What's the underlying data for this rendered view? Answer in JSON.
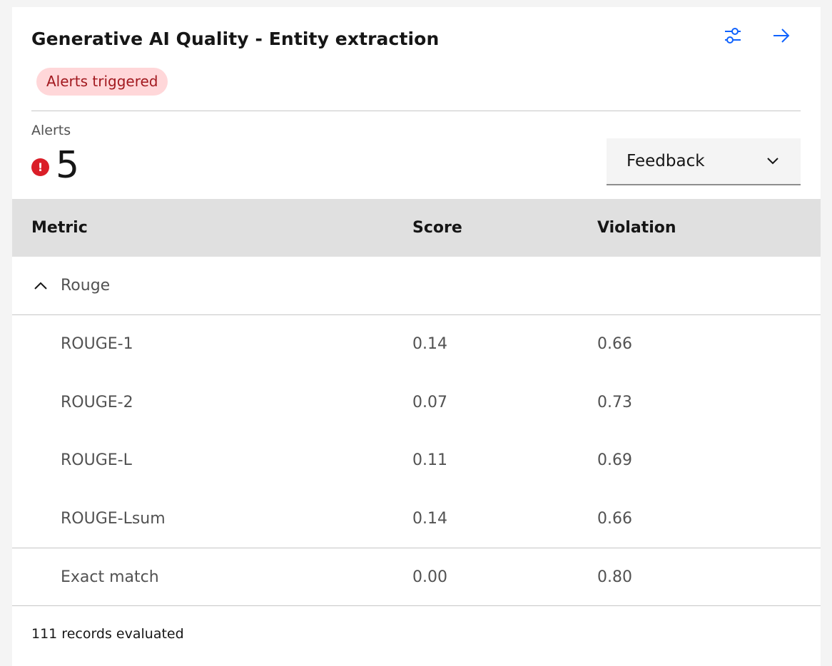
{
  "card": {
    "title": "Generative AI Quality - Entity extraction",
    "badge": "Alerts triggered",
    "alerts_label": "Alerts",
    "alerts_count": "5",
    "alert_icon_glyph": "!",
    "dropdown_value": "Feedback",
    "footer": "111 records evaluated"
  },
  "icons": {
    "settings": "settings-adjust-icon",
    "arrow": "arrow-right-icon",
    "chevron_down": "chevron-down-icon",
    "chevron_up": "chevron-up-icon",
    "alert": "error-filled-icon"
  },
  "colors": {
    "accent": "#0f62fe",
    "badge_bg": "#ffd7d9",
    "badge_text": "#a2191f",
    "alert_red": "#da1e28",
    "header_bg": "#e0e0e0"
  },
  "table": {
    "columns": [
      "Metric",
      "Score",
      "Violation"
    ],
    "group": {
      "label": "Rouge",
      "expanded": true
    },
    "rows": [
      {
        "metric": "ROUGE-1",
        "score": "0.14",
        "violation": "0.66"
      },
      {
        "metric": "ROUGE-2",
        "score": "0.07",
        "violation": "0.73"
      },
      {
        "metric": "ROUGE-L",
        "score": "0.11",
        "violation": "0.69"
      },
      {
        "metric": "ROUGE-Lsum",
        "score": "0.14",
        "violation": "0.66"
      },
      {
        "metric": "Exact match",
        "score": "0.00",
        "violation": "0.80"
      }
    ]
  }
}
